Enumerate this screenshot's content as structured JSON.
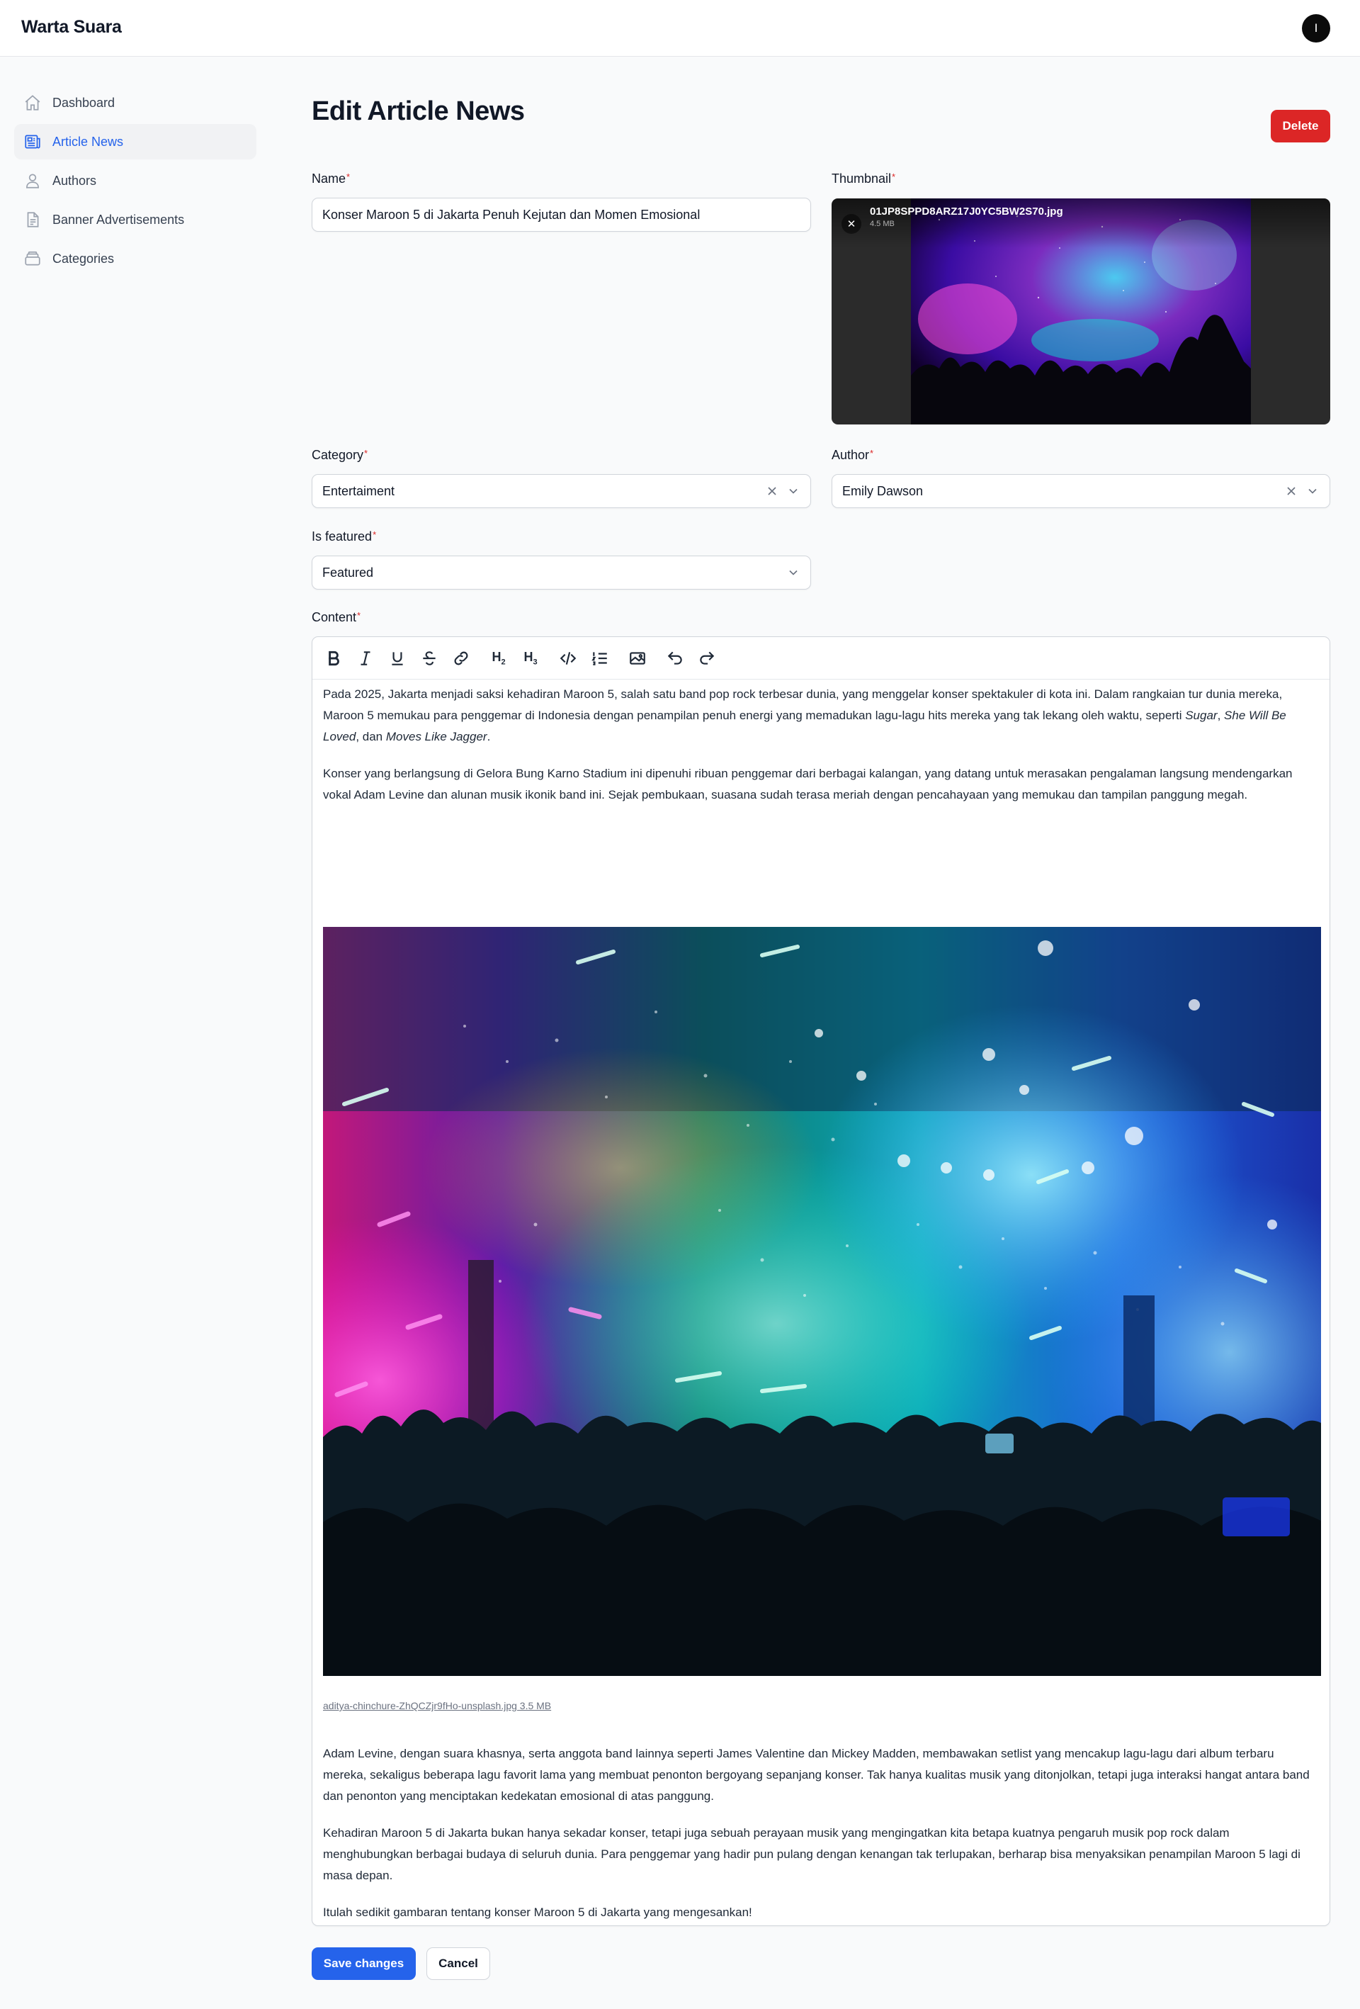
{
  "app": {
    "brand": "Warta Suara",
    "user_initial": "I"
  },
  "sidebar": {
    "items": [
      {
        "label": "Dashboard",
        "icon": "home-icon",
        "active": false
      },
      {
        "label": "Article News",
        "icon": "newspaper-icon",
        "active": true
      },
      {
        "label": "Authors",
        "icon": "user-icon",
        "active": false
      },
      {
        "label": "Banner Advertisements",
        "icon": "document-icon",
        "active": false
      },
      {
        "label": "Categories",
        "icon": "stack-icon",
        "active": false
      }
    ]
  },
  "page": {
    "title": "Edit Article News",
    "delete_label": "Delete"
  },
  "form": {
    "name": {
      "label": "Name",
      "required": "*",
      "value": "Konser Maroon 5 di Jakarta Penuh Kejutan dan Momen Emosional"
    },
    "thumbnail": {
      "label": "Thumbnail",
      "required": "*",
      "file_name": "01JP8SPPD8ARZ17J0YC5BW2S70.jpg",
      "file_size": "4.5 MB"
    },
    "category": {
      "label": "Category",
      "required": "*",
      "value": "Entertaiment"
    },
    "author": {
      "label": "Author",
      "required": "*",
      "value": "Emily Dawson"
    },
    "is_featured": {
      "label": "Is featured",
      "required": "*",
      "value": "Featured"
    },
    "content": {
      "label": "Content",
      "required": "*",
      "toolbar": [
        "bold-icon",
        "italic-icon",
        "underline-icon",
        "strike-icon",
        "link-icon",
        "h2-icon",
        "h3-icon",
        "code-icon",
        "ordered-list-icon",
        "image-icon",
        "undo-icon",
        "redo-icon"
      ],
      "p1_a": "Pada 2025, Jakarta menjadi saksi kehadiran Maroon 5, salah satu band pop rock terbesar dunia, yang menggelar konser spektakuler di kota ini. Dalam rangkaian tur dunia mereka, Maroon 5 memukau para penggemar di Indonesia dengan penampilan penuh energi yang memadukan lagu-lagu hits mereka yang tak lekang oleh waktu, seperti ",
      "p1_song1": "Sugar",
      "p1_sep": ", ",
      "p1_song2": "She Will Be Loved",
      "p1_and": ", dan ",
      "p1_song3": "Moves Like Jagger",
      "p1_end": ".",
      "p2": "Konser yang berlangsung di Gelora Bung Karno Stadium ini dipenuhi ribuan penggemar dari berbagai kalangan, yang datang untuk merasakan pengalaman langsung mendengarkan vokal Adam Levine dan alunan musik ikonik band ini. Sejak pembukaan, suasana sudah terasa meriah dengan pencahayaan yang memukau dan tampilan panggung megah.",
      "image_caption": "aditya-chinchure-ZhQCZjr9fHo-unsplash.jpg 3.5 MB",
      "p3": "Adam Levine, dengan suara khasnya, serta anggota band lainnya seperti James Valentine dan Mickey Madden, membawakan setlist yang mencakup lagu-lagu dari album terbaru mereka, sekaligus beberapa lagu favorit lama yang membuat penonton bergoyang sepanjang konser. Tak hanya kualitas musik yang ditonjolkan, tetapi juga interaksi hangat antara band dan penonton yang menciptakan kedekatan emosional di atas panggung.",
      "p4": "Kehadiran Maroon 5 di Jakarta bukan hanya sekadar konser, tetapi juga sebuah perayaan musik yang mengingatkan kita betapa kuatnya pengaruh musik pop rock dalam menghubungkan berbagai budaya di seluruh dunia. Para penggemar yang hadir pun pulang dengan kenangan tak terlupakan, berharap bisa menyaksikan penampilan Maroon 5 lagi di masa depan.",
      "p5": "Itulah sedikit gambaran tentang konser Maroon 5 di Jakarta yang mengesankan!"
    }
  },
  "actions": {
    "save_label": "Save changes",
    "cancel_label": "Cancel"
  },
  "colors": {
    "primary": "#2563eb",
    "danger": "#dc2626",
    "required": "#dc2626"
  }
}
